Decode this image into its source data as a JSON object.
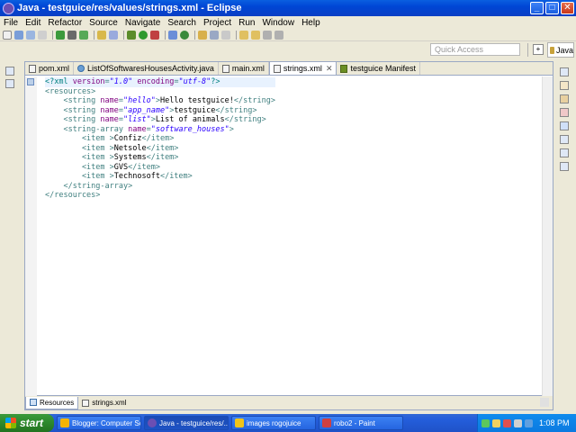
{
  "window": {
    "title": "Java - testguice/res/values/strings.xml - Eclipse"
  },
  "menu": [
    "File",
    "Edit",
    "Refactor",
    "Source",
    "Navigate",
    "Search",
    "Project",
    "Run",
    "Window",
    "Help"
  ],
  "quick_access": {
    "placeholder": "Quick Access"
  },
  "perspective": {
    "label": "Java"
  },
  "tabs": [
    {
      "label": "pom.xml",
      "icon": "xml-file-icon",
      "active": false
    },
    {
      "label": "ListOfSoftwaresHousesActivity.java",
      "icon": "java-file-icon",
      "active": false
    },
    {
      "label": "main.xml",
      "icon": "xml-file-icon",
      "active": false
    },
    {
      "label": "strings.xml",
      "icon": "xml-file-icon",
      "active": true
    },
    {
      "label": "testguice Manifest",
      "icon": "manifest-icon",
      "active": false
    }
  ],
  "code": [
    [
      [
        "decl",
        "<?xml "
      ],
      [
        "attr",
        "version"
      ],
      [
        "tag",
        "="
      ],
      [
        "val",
        "\"1.0\""
      ],
      [
        "tag",
        " "
      ],
      [
        "attr",
        "encoding"
      ],
      [
        "tag",
        "="
      ],
      [
        "val",
        "\"utf-8\""
      ],
      [
        "decl",
        "?>"
      ]
    ],
    [
      [
        "tag",
        "<resources>"
      ]
    ],
    [
      [
        "tag",
        "    <string "
      ],
      [
        "attr",
        "name"
      ],
      [
        "tag",
        "="
      ],
      [
        "val",
        "\"hello\""
      ],
      [
        "tag",
        ">"
      ],
      [
        "plain",
        "Hello testguice!"
      ],
      [
        "tag",
        "</string>"
      ]
    ],
    [
      [
        "tag",
        "    <string "
      ],
      [
        "attr",
        "name"
      ],
      [
        "tag",
        "="
      ],
      [
        "val",
        "\"app_name\""
      ],
      [
        "tag",
        ">"
      ],
      [
        "plain",
        "testguice"
      ],
      [
        "tag",
        "</string>"
      ]
    ],
    [
      [
        "tag",
        "    <string "
      ],
      [
        "attr",
        "name"
      ],
      [
        "tag",
        "="
      ],
      [
        "val",
        "\"list\""
      ],
      [
        "tag",
        ">"
      ],
      [
        "plain",
        "List of animals"
      ],
      [
        "tag",
        "</string>"
      ]
    ],
    [
      [
        "tag",
        "    <string-array "
      ],
      [
        "attr",
        "name"
      ],
      [
        "tag",
        "="
      ],
      [
        "val",
        "\"software_houses\""
      ],
      [
        "tag",
        ">"
      ]
    ],
    [
      [
        "tag",
        "        <item >"
      ],
      [
        "plain",
        "Confiz"
      ],
      [
        "tag",
        "</item>"
      ]
    ],
    [
      [
        "tag",
        "        <item >"
      ],
      [
        "plain",
        "Netsole"
      ],
      [
        "tag",
        "</item>"
      ]
    ],
    [
      [
        "tag",
        "        <item >"
      ],
      [
        "plain",
        "Systems"
      ],
      [
        "tag",
        "</item>"
      ]
    ],
    [
      [
        "tag",
        "        <item >"
      ],
      [
        "plain",
        "GVS"
      ],
      [
        "tag",
        "</item>"
      ]
    ],
    [
      [
        "tag",
        "        <item >"
      ],
      [
        "plain",
        "Technosoft"
      ],
      [
        "tag",
        "</item>"
      ]
    ],
    [
      [
        "tag",
        "    </string-array>"
      ]
    ],
    [
      [
        "tag",
        "</resources>"
      ]
    ]
  ],
  "bottom_tabs": [
    {
      "label": "Resources",
      "active": true
    },
    {
      "label": "strings.xml",
      "active": false
    }
  ],
  "taskbar": {
    "start": "start",
    "tasks": [
      {
        "label": "Blogger: Computer Sc...",
        "color": "#f4b400",
        "active": false
      },
      {
        "label": "Java - testguice/res/...",
        "color": "#6b4fb3",
        "active": true
      },
      {
        "label": "images rogojuice",
        "color": "#f0c419",
        "active": false
      },
      {
        "label": "robo2 - Paint",
        "color": "#d04040",
        "active": false
      }
    ],
    "clock": "1:08 PM"
  }
}
